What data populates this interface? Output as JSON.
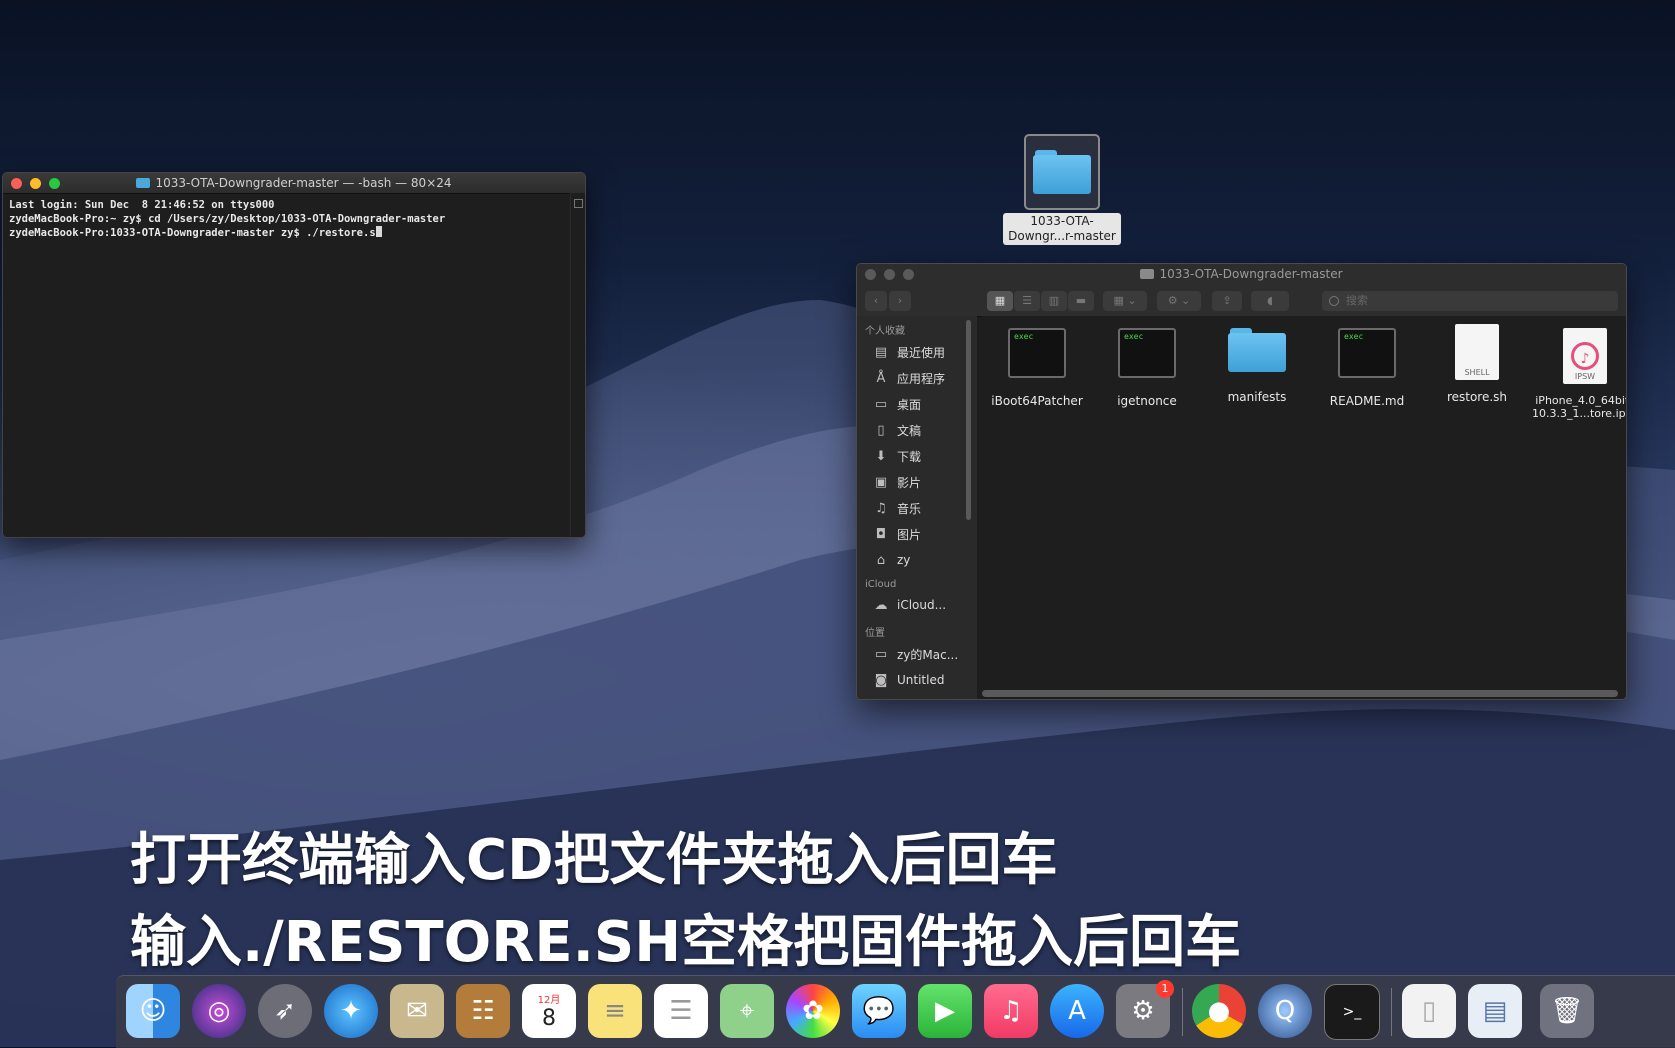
{
  "terminal": {
    "title": "1033-OTA-Downgrader-master — -bash — 80×24",
    "lines": [
      "Last login: Sun Dec  8 21:46:52 on ttys000",
      "zydeMacBook-Pro:~ zy$ cd /Users/zy/Desktop/1033-OTA-Downgrader-master",
      "zydeMacBook-Pro:1033-OTA-Downgrader-master zy$ ./restore.s"
    ]
  },
  "desktop_folder": {
    "label_line1": "1033-OTA-",
    "label_line2": "Downgr...r-master"
  },
  "finder": {
    "title": "1033-OTA-Downgrader-master",
    "search_placeholder": "搜索",
    "sidebar": {
      "favorites_header": "个人收藏",
      "favorites": [
        {
          "label": "最近使用",
          "icon": "recents-icon"
        },
        {
          "label": "应用程序",
          "icon": "applications-icon"
        },
        {
          "label": "桌面",
          "icon": "desktop-icon"
        },
        {
          "label": "文稿",
          "icon": "documents-icon"
        },
        {
          "label": "下载",
          "icon": "downloads-icon"
        },
        {
          "label": "影片",
          "icon": "movies-icon"
        },
        {
          "label": "音乐",
          "icon": "music-icon"
        },
        {
          "label": "图片",
          "icon": "pictures-icon"
        },
        {
          "label": "zy",
          "icon": "home-icon"
        }
      ],
      "icloud_header": "iCloud",
      "icloud": [
        {
          "label": "iCloud...",
          "icon": "cloud-icon"
        }
      ],
      "locations_header": "位置",
      "locations": [
        {
          "label": "zy的Mac...",
          "icon": "laptop-icon"
        },
        {
          "label": "Untitled",
          "icon": "disk-icon"
        }
      ]
    },
    "files": [
      {
        "name": "iBoot64Patcher",
        "kind": "exec",
        "badge": "exec"
      },
      {
        "name": "igetnonce",
        "kind": "exec",
        "badge": "exec"
      },
      {
        "name": "manifests",
        "kind": "folder"
      },
      {
        "name": "README.md",
        "kind": "exec",
        "badge": "exec"
      },
      {
        "name": "restore.sh",
        "kind": "shell",
        "badge": "SHELL"
      },
      {
        "name": "iPhone_4.0_64bit_",
        "name2": "10.3.3_1...tore.ipsw",
        "kind": "ipsw",
        "badge": "IPSW"
      }
    ]
  },
  "subtitles": {
    "line1": "打开终端输入CD把文件夹拖入后回车",
    "line2": "输入./RESTORE.SH空格把固件拖入后回车"
  },
  "dock": {
    "calendar_month": "12月",
    "calendar_day": "8",
    "preferences_badge": "1"
  }
}
